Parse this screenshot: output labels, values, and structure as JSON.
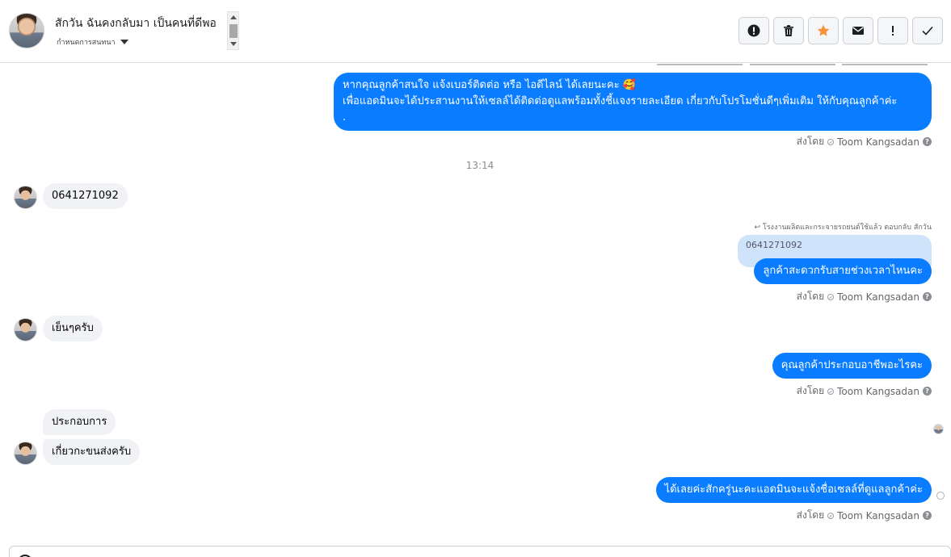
{
  "header": {
    "contact_name": "สักวัน ฉันคงกลับมา เป็นคนที่ดีพอ",
    "stage_label": "กำหนดการสนทนา"
  },
  "toolbar": {
    "buttons": [
      {
        "icon": "alert-circle-icon"
      },
      {
        "icon": "trash-icon"
      },
      {
        "icon": "star-icon",
        "color": "#f7923a"
      },
      {
        "icon": "envelope-icon"
      },
      {
        "icon": "exclamation-icon"
      },
      {
        "icon": "check-icon"
      }
    ]
  },
  "messages": {
    "m1_line1": "หากคุณลูกค้าสนใจ แจ้งเบอร์ติดต่อ หรือ ไอดีไลน์ ได้เลยนะคะ 🥰",
    "m1_line2": "เพื่อแอดมินจะได้ประสานงานให้เซลล์ได้ติดต่อดูแลพร้อมทั้งชี้แจงรายละเอียด เกี่ยวกับโปรโมชั่นดีๆเพิ่มเติม ให้กับคุณลูกค้าค่ะ",
    "m1_line3": ".",
    "sent_by_prefix": "ส่งโดย",
    "sent_by_name": "Toom Kangsadan",
    "timestamp": "13:14",
    "in_phone": "0641271092",
    "reply_label": "↩ โรงงานผลิตและกระจายรถยนต์ใช้แล้ว ตอบกลับ สักวัน",
    "reply_quote": "0641271092",
    "m2": "ลูกค้าสะดวกรับสายช่วงเวลาไหนคะ",
    "in_evening": "เย็นๆครับ",
    "m3": "คุณลูกค้าประกอบอาชีพอะไรคะ",
    "in_business": "ประกอบการ",
    "in_transport": "เกี่ยวกะขนส่งครับ",
    "m4": "ได้เลยค่ะสักครู่นะคะแอดมินจะแจ้งชื่อเซลล์ที่ดูแลลูกค้าค่ะ"
  },
  "colors": {
    "outgoing_bubble": "#0a7cff",
    "incoming_bubble": "#f0f2f5",
    "star": "#f7923a"
  }
}
